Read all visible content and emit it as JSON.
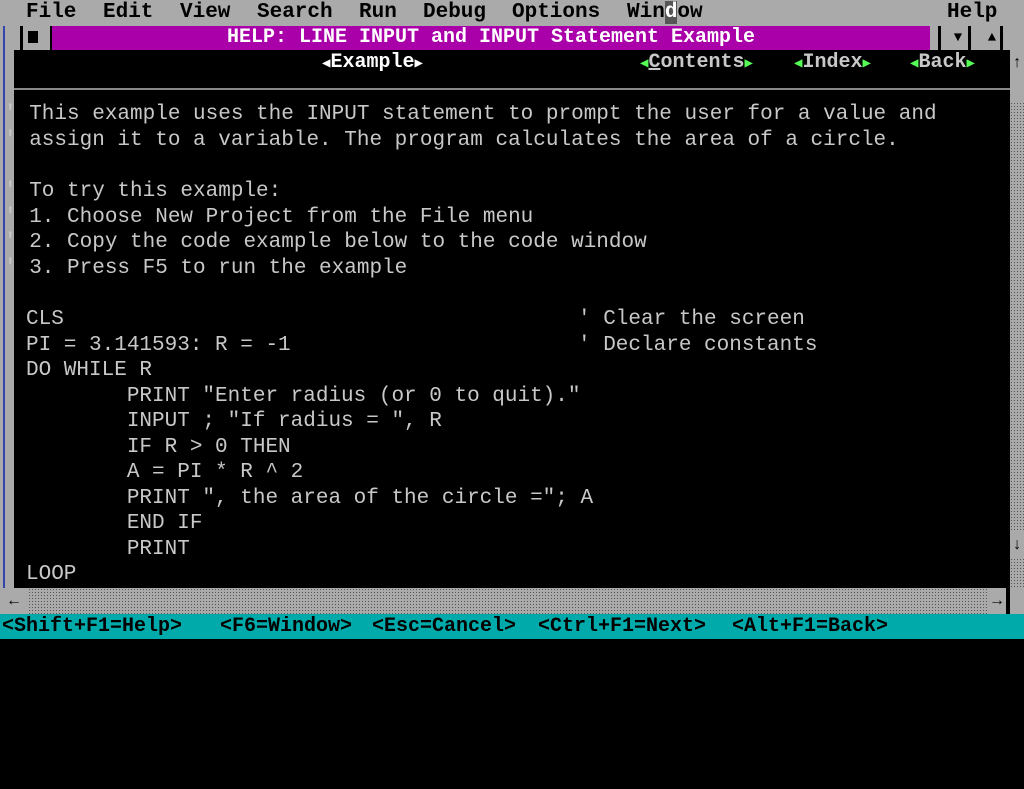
{
  "menubar": {
    "items": [
      {
        "label": "File"
      },
      {
        "label": "Edit"
      },
      {
        "label": "View"
      },
      {
        "label": "Search"
      },
      {
        "label": "Run"
      },
      {
        "label": "Debug"
      },
      {
        "label": "Options"
      },
      {
        "label": "Window",
        "cursor_char_index": 3
      },
      {
        "label": "Help"
      }
    ]
  },
  "window": {
    "title": "HELP: LINE INPUT and INPUT Statement Example",
    "close_icon": "close-box-icon",
    "minimize_icon": "down-triangle-icon",
    "maximize_icon": "up-triangle-icon"
  },
  "nav": {
    "current": "Example",
    "links": [
      {
        "label": "Contents",
        "hotkey_index": 0
      },
      {
        "label": "Index"
      },
      {
        "label": "Back"
      }
    ]
  },
  "content": {
    "comment_lines": [
      "' This example uses the INPUT statement to prompt the user for a value and",
      "' assign it to a variable. The program calculates the area of a circle.",
      "",
      "' To try this example:",
      "' 1. Choose New Project from the File menu",
      "' 2. Copy the code example below to the code window",
      "' 3. Press F5 to run the example",
      ""
    ],
    "code_lines": [
      {
        "code": "CLS",
        "comment": "' Clear the screen"
      },
      {
        "code": "PI = 3.141593: R = -1",
        "comment": "' Declare constants"
      },
      {
        "code": "DO WHILE R",
        "comment": ""
      },
      {
        "code": "        PRINT \"Enter radius (or 0 to quit).\"",
        "comment": ""
      },
      {
        "code": "        INPUT ; \"If radius = \", R",
        "comment": ""
      },
      {
        "code": "        IF R > 0 THEN",
        "comment": ""
      },
      {
        "code": "        A = PI * R ^ 2",
        "comment": ""
      },
      {
        "code": "        PRINT \", the area of the circle =\"; A",
        "comment": ""
      },
      {
        "code": "        END IF",
        "comment": ""
      },
      {
        "code": "        PRINT",
        "comment": ""
      },
      {
        "code": "LOOP",
        "comment": ""
      }
    ]
  },
  "scrollbars": {
    "vertical": {
      "up": "↑",
      "down": "↓"
    },
    "horizontal": {
      "left": "←",
      "right": "→"
    }
  },
  "statusbar": {
    "items": [
      "<Shift+F1=Help>",
      "<F6=Window>",
      "<Esc=Cancel>",
      "<Ctrl+F1=Next>",
      "<Alt+F1=Back>"
    ]
  },
  "colors": {
    "menubar_bg": "#aaaaaa",
    "title_bg": "#aa00aa",
    "content_bg": "#000000",
    "text": "#c8c8c8",
    "nav_arrow": "#55ff55",
    "statusbar_bg": "#00aaaa"
  }
}
